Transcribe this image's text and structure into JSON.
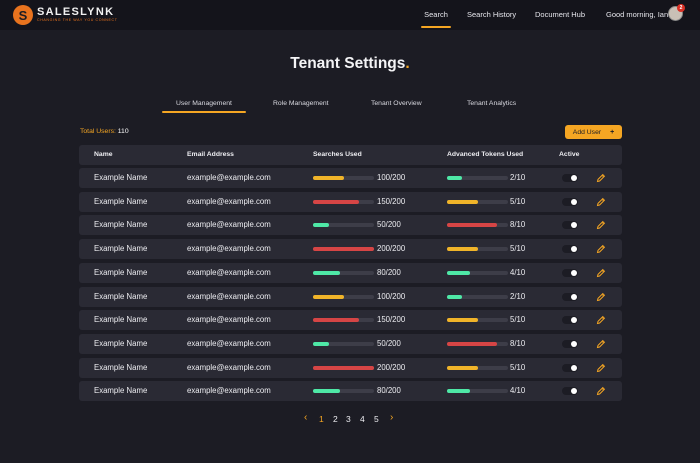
{
  "brand": {
    "name": "SALESLYNK",
    "tagline": "CHANGING THE WAY YOU CONNECT",
    "mark": "S",
    "accent": "#f5a623",
    "logo_color": "#e8731e"
  },
  "nav": {
    "search": "Search",
    "history": "Search History",
    "docs": "Document Hub",
    "greeting": "Good morning, Ian",
    "notifications": "2"
  },
  "page": {
    "title": "Tenant Settings",
    "title_dot": "."
  },
  "tabs": [
    "User Management",
    "Role Management",
    "Tenant Overview",
    "Tenant Analytics"
  ],
  "summary": {
    "total_label": "Total Users:",
    "total_value": "110",
    "add_label": "Add User",
    "add_icon": "+"
  },
  "table": {
    "headers": {
      "name": "Name",
      "email": "Email Address",
      "searches": "Searches Used",
      "tokens": "Advanced Tokens Used",
      "active": "Active"
    },
    "rows": [
      {
        "name": "Example Name",
        "email": "example@example.com",
        "searches": "100/200",
        "searches_frac": 0.5,
        "searches_color": "#f0b429",
        "tokens": "2/10",
        "tokens_frac": 0.25,
        "tokens_color": "#4ee8a6",
        "active": true
      },
      {
        "name": "Example Name",
        "email": "example@example.com",
        "searches": "150/200",
        "searches_frac": 0.75,
        "searches_color": "#d64545",
        "tokens": "5/10",
        "tokens_frac": 0.5,
        "tokens_color": "#f0b429",
        "active": true
      },
      {
        "name": "Example Name",
        "email": "example@example.com",
        "searches": "50/200",
        "searches_frac": 0.27,
        "searches_color": "#4ee8a6",
        "tokens": "8/10",
        "tokens_frac": 0.82,
        "tokens_color": "#d64545",
        "active": true
      },
      {
        "name": "Example Name",
        "email": "example@example.com",
        "searches": "200/200",
        "searches_frac": 1.0,
        "searches_color": "#d64545",
        "tokens": "5/10",
        "tokens_frac": 0.5,
        "tokens_color": "#f0b429",
        "active": true
      },
      {
        "name": "Example Name",
        "email": "example@example.com",
        "searches": "80/200",
        "searches_frac": 0.45,
        "searches_color": "#4ee8a6",
        "tokens": "4/10",
        "tokens_frac": 0.38,
        "tokens_color": "#4ee8a6",
        "active": true
      },
      {
        "name": "Example Name",
        "email": "example@example.com",
        "searches": "100/200",
        "searches_frac": 0.5,
        "searches_color": "#f0b429",
        "tokens": "2/10",
        "tokens_frac": 0.25,
        "tokens_color": "#4ee8a6",
        "active": true
      },
      {
        "name": "Example Name",
        "email": "example@example.com",
        "searches": "150/200",
        "searches_frac": 0.75,
        "searches_color": "#d64545",
        "tokens": "5/10",
        "tokens_frac": 0.5,
        "tokens_color": "#f0b429",
        "active": true
      },
      {
        "name": "Example Name",
        "email": "example@example.com",
        "searches": "50/200",
        "searches_frac": 0.27,
        "searches_color": "#4ee8a6",
        "tokens": "8/10",
        "tokens_frac": 0.82,
        "tokens_color": "#d64545",
        "active": true
      },
      {
        "name": "Example Name",
        "email": "example@example.com",
        "searches": "200/200",
        "searches_frac": 1.0,
        "searches_color": "#d64545",
        "tokens": "5/10",
        "tokens_frac": 0.5,
        "tokens_color": "#f0b429",
        "active": true
      },
      {
        "name": "Example Name",
        "email": "example@example.com",
        "searches": "80/200",
        "searches_frac": 0.45,
        "searches_color": "#4ee8a6",
        "tokens": "4/10",
        "tokens_frac": 0.38,
        "tokens_color": "#4ee8a6",
        "active": true
      }
    ]
  },
  "pagination": {
    "prev": "‹",
    "pages": [
      "1",
      "2",
      "3",
      "4",
      "5"
    ],
    "current": "1",
    "next": "›"
  }
}
